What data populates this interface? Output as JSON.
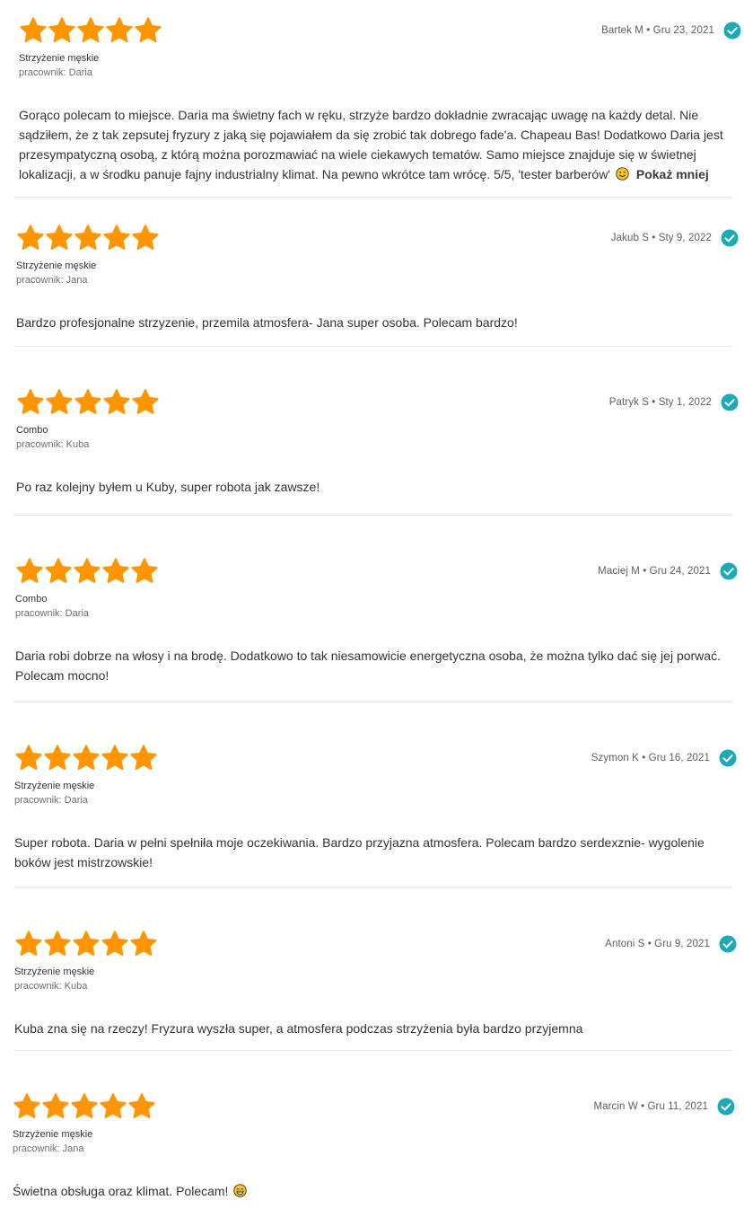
{
  "colors": {
    "star": "#ff9500",
    "check": "#1eaab5",
    "divider": "#e8e8e8"
  },
  "icons": {
    "star": "star-icon",
    "verified": "verified-check-icon",
    "emoji_smile": "smile-emoji-icon",
    "emoji_grin": "grin-emoji-icon"
  },
  "reviews": [
    {
      "rating": 5,
      "author": "Bartek M • Gru 23, 2021",
      "service": "Strzyżenie męskie",
      "employee": "pracownik: Daria",
      "text": "Gorąco polecam to miejsce. Daria ma świetny fach w ręku, strzyże bardzo dokładnie zwracając uwagę na każdy detal. Nie sądziłem, że z tak zepsutej fryzury z jaką się pojawiałem da się zrobić tak dobrego fade'a. Chapeau Bas! Dodatkowo Daria jest przesympatyczną osobą, z którą można porozmawiać na wiele ciekawych tematów. Samo miejsce znajduje się w świetnej lokalizacji, a w środku panuje fajny industrialny klimat. Na pewno wkrótce tam wrócę. 5/5, 'tester barberów'",
      "show_less": "Pokaż mniej"
    },
    {
      "rating": 5,
      "author": "Jakub S • Sty 9, 2022",
      "service": "Strzyżenie męskie",
      "employee": "pracownik: Jana",
      "text": "Bardzo profesjonalne strzyzenie, przemila atmosfera- Jana super osoba. Polecam bardzo!"
    },
    {
      "rating": 5,
      "author": "Patryk S • Sty 1, 2022",
      "service": "Combo",
      "employee": "pracownik: Kuba",
      "text": "Po raz kolejny byłem u Kuby, super robota jak zawsze!"
    },
    {
      "rating": 5,
      "author": "Maciej M • Gru 24, 2021",
      "service": "Combo",
      "employee": "pracownik: Daria",
      "text": "Daria robi dobrze na włosy i na brodę. Dodatkowo to tak niesamowicie energetyczna osoba, że można tylko dać się jej porwać. Polecam mocno!"
    },
    {
      "rating": 5,
      "author": "Szymon K • Gru 16, 2021",
      "service": "Strzyżenie męskie",
      "employee": "pracownik: Daria",
      "text": "Super robota. Daria w pełni spełniła moje oczekiwania. Bardzo przyjazna atmosfera. Polecam bardzo serdexznie- wygolenie boków jest mistrzowskie!"
    },
    {
      "rating": 5,
      "author": "Antoni S • Gru 9, 2021",
      "service": "Strzyżenie męskie",
      "employee": "pracownik: Kuba",
      "text": "Kuba zna się na rzeczy! Fryzura wyszła super, a atmosfera podczas strzyżenia była bardzo przyjemna"
    },
    {
      "rating": 5,
      "author": "Marcin W • Gru 11, 2021",
      "service": "Strzyżenie męskie",
      "employee": "pracownik: Jana",
      "text": "Świetna obsługa oraz klimat. Polecam!"
    }
  ]
}
